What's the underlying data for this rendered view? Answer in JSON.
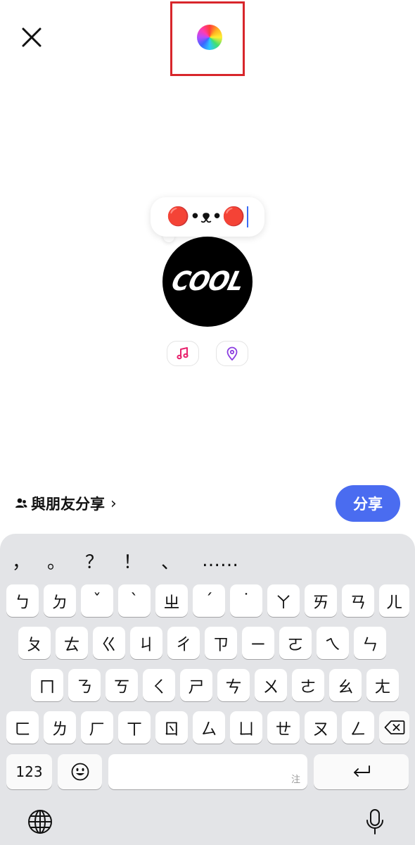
{
  "header": {
    "close_icon": "close-icon",
    "color_picker_icon": "rainbow-color-dot"
  },
  "note": {
    "text": "🔴•ᴥ•🔴"
  },
  "avatar": {
    "text": "COOL"
  },
  "actions": {
    "music_icon": "music-note-icon",
    "location_icon": "location-pin-icon",
    "music_color": "#e8226d",
    "location_color": "#8a3ce0"
  },
  "share": {
    "audience_label": "與朋友分享",
    "chevron": "›",
    "button_label": "分享",
    "button_color": "#4a6cf0"
  },
  "keyboard": {
    "punctuation": [
      "，",
      "。",
      "？",
      "！",
      "、",
      "……"
    ],
    "rows": [
      [
        "ㄅ",
        "ㄉ",
        "ˇ",
        "ˋ",
        "ㄓ",
        "ˊ",
        "˙",
        "ㄚ",
        "ㄞ",
        "ㄢ",
        "ㄦ"
      ],
      [
        "ㄆ",
        "ㄊ",
        "ㄍ",
        "ㄐ",
        "ㄔ",
        "ㄗ",
        "ㄧ",
        "ㄛ",
        "ㄟ",
        "ㄣ"
      ],
      [
        "ㄇ",
        "ㄋ",
        "ㄎ",
        "ㄑ",
        "ㄕ",
        "ㄘ",
        "ㄨ",
        "ㄜ",
        "ㄠ",
        "ㄤ"
      ],
      [
        "ㄈ",
        "ㄌ",
        "ㄏ",
        "ㄒ",
        "ㄖ",
        "ㄙ",
        "ㄩ",
        "ㄝ",
        "ㄡ",
        "ㄥ"
      ]
    ],
    "numbers_key": "123",
    "emoji_key_icon": "emoji-icon",
    "space_hint": "注",
    "return_key_icon": "return-icon",
    "backspace_icon": "backspace-icon",
    "globe_icon": "globe-icon",
    "mic_icon": "microphone-icon"
  }
}
